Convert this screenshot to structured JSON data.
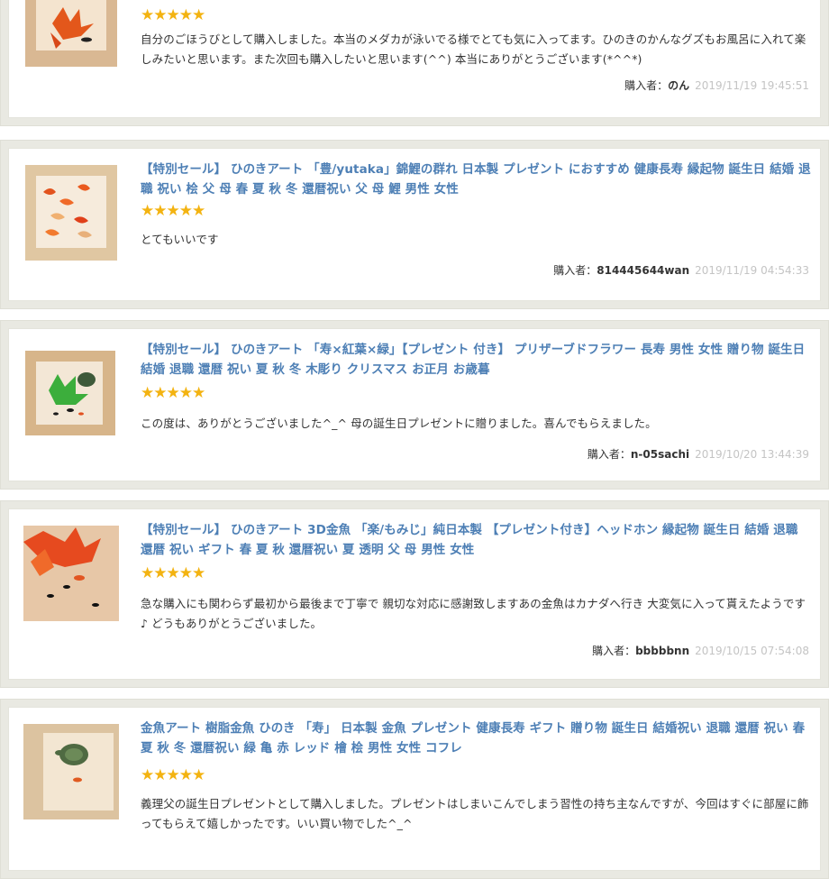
{
  "reviews": [
    {
      "title": "",
      "rating": "★★★★★",
      "comment": "自分のごほうびとして購入しました。本当のメダカが泳いでる様でとても気に入ってます。ひのきのかんなグズもお風呂に入れて楽しみたいと思います。また次回も購入したいと思います(^^) 本当にありがとうございます(*^^*)",
      "buyer_label": "購入者：",
      "buyer_name": "のん",
      "timestamp": "2019/11/19 19:45:51"
    },
    {
      "title": "【特別セール】 ひのきアート 「豊/yutaka」錦鯉の群れ 日本製 プレゼント におすすめ 健康長寿 縁起物 誕生日 結婚 退職 祝い 桧 父 母 春 夏 秋 冬 還暦祝い 父 母 鯉 男性 女性",
      "rating": "★★★★★",
      "comment": "とてもいいです",
      "buyer_label": "購入者：",
      "buyer_name": "814445644wan",
      "timestamp": "2019/11/19 04:54:33"
    },
    {
      "title": "【特別セール】 ひのきアート 「寿×紅葉×緑」【プレゼント 付き】 プリザーブドフラワー 長寿 男性 女性 贈り物 誕生日 結婚 退職 還暦 祝い 夏 秋 冬 木彫り クリスマス お正月 お歳暮",
      "rating": "★★★★★",
      "comment": "この度は、ありがとうございました^_^ 母の誕生日プレゼントに贈りました。喜んでもらえました。",
      "buyer_label": "購入者：",
      "buyer_name": "n-05sachi",
      "timestamp": "2019/10/20 13:44:39"
    },
    {
      "title": "【特別セール】 ひのきアート 3D金魚 「楽/もみじ」純日本製 【プレゼント付き】ヘッドホン 縁起物 誕生日 結婚 退職 還暦 祝い ギフト 春 夏 秋 還暦祝い 夏 透明 父 母 男性 女性",
      "rating": "★★★★★",
      "comment": "急な購入にも関わらず最初から最後まで丁寧で 親切な対応に感謝致しますあの金魚はカナダへ行き 大変気に入って貰えたようです♪ どうもありがとうございました。",
      "buyer_label": "購入者：",
      "buyer_name": "bbbbbnn",
      "timestamp": "2019/10/15 07:54:08"
    },
    {
      "title": "金魚アート 樹脂金魚 ひのき 「寿」 日本製 金魚 プレゼント 健康長寿 ギフト 贈り物 誕生日 結婚祝い 退職 還暦 祝い 春 夏 秋 冬 還暦祝い 緑 亀 赤 レッド 檜 桧 男性 女性 コフレ",
      "rating": "★★★★★",
      "comment": "義理父の誕生日プレゼントとして購入しました。プレゼントはしまいこんでしまう習性の持ち主なんですが、今回はすぐに部屋に飾ってもらえて嬉しかったです。いい買い物でした^_^",
      "buyer_label": "",
      "buyer_name": "",
      "timestamp": ""
    }
  ]
}
